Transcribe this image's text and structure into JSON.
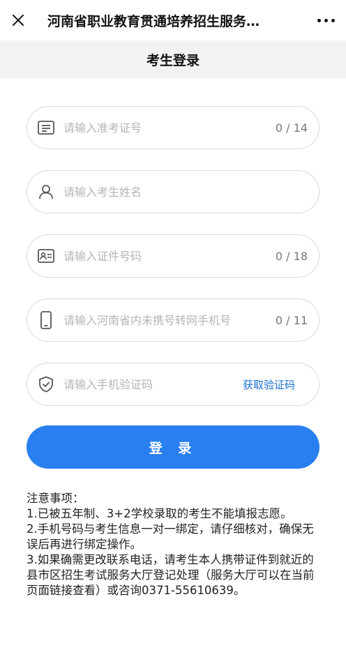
{
  "header": {
    "title": "河南省职业教育贯通培养招生服务…",
    "close_icon": "close-icon",
    "more_icon": "more-icon"
  },
  "page": {
    "title": "考生登录"
  },
  "form": {
    "exam_number": {
      "placeholder": "请输入准考证号",
      "value": "",
      "counter": "0 / 14",
      "icon": "id-card-icon"
    },
    "name": {
      "placeholder": "请输入考生姓名",
      "value": "",
      "icon": "user-icon"
    },
    "id_number": {
      "placeholder": "请输入证件号码",
      "value": "",
      "counter": "0 / 18",
      "icon": "id-document-icon"
    },
    "phone": {
      "placeholder": "请输入河南省内未携号转网手机号",
      "value": "",
      "counter": "0 / 11",
      "icon": "phone-icon"
    },
    "sms_code": {
      "placeholder": "请输入手机验证码",
      "value": "",
      "action_label": "获取验证码",
      "icon": "shield-check-icon"
    },
    "login_label": "登 录"
  },
  "notice": {
    "heading": "注意事项：",
    "items": [
      "1.已被五年制、3+2学校录取的考生不能填报志愿。",
      "2.手机号码与考生信息一对一绑定，请仔细核对，确保无误后再进行绑定操作。",
      "3.如果确需更改联系电话，请考生本人携带证件到就近的县市区招生考试服务大厅登记处理（服务大厅可以在当前页面链接查看）或咨询0371-55610639。"
    ]
  },
  "colors": {
    "primary": "#2a7ff0",
    "link": "#1a6fce",
    "subheader_bg": "#f2f2f2"
  }
}
